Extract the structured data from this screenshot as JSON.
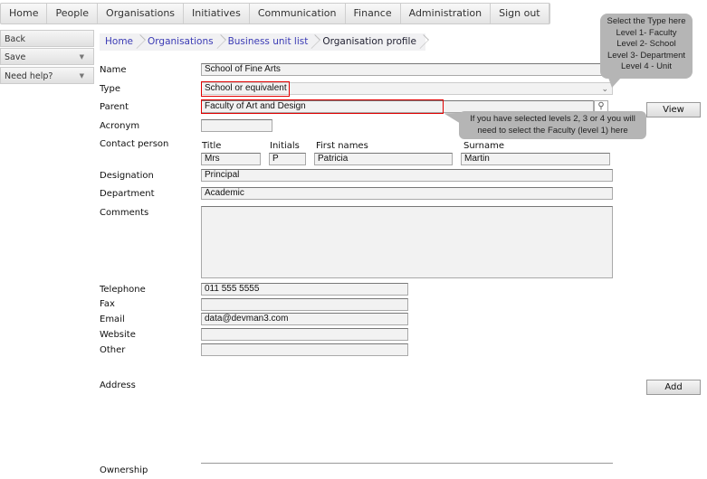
{
  "nav": [
    "Home",
    "People",
    "Organisations",
    "Initiatives",
    "Communication",
    "Finance",
    "Administration",
    "Sign out"
  ],
  "sidebar": {
    "back": "Back",
    "save": "Save",
    "help": "Need help?"
  },
  "breadcrumb": [
    "Home",
    "Organisations",
    "Business unit list",
    "Organisation profile"
  ],
  "form": {
    "name_label": "Name",
    "name": "School of Fine Arts",
    "type_label": "Type",
    "type": "School or equivalent",
    "parent_label": "Parent",
    "parent": "Faculty of Art and Design",
    "view": "View",
    "acronym_label": "Acronym",
    "acronym": "",
    "contact_label": "Contact person",
    "title_label": "Title",
    "title": "Mrs",
    "initials_label": "Initials",
    "initials": "P",
    "first_label": "First names",
    "first": "Patricia",
    "surname_label": "Surname",
    "surname": "Martin",
    "designation_label": "Designation",
    "designation": "Principal",
    "department_label": "Department",
    "department": "Academic",
    "comments_label": "Comments",
    "comments": "",
    "telephone_label": "Telephone",
    "telephone": "011 555 5555",
    "fax_label": "Fax",
    "fax": "",
    "email_label": "Email",
    "email": "data@devman3.com",
    "website_label": "Website",
    "website": "",
    "other_label": "Other",
    "other": "",
    "address_label": "Address",
    "add": "Add",
    "ownership_label": "Ownership"
  },
  "tips": {
    "type": [
      "Select the Type here",
      "Level 1- Faculty",
      "Level 2- School",
      "Level 3- Department",
      "Level 4 - Unit"
    ],
    "parent": [
      "If you have selected levels 2, 3 or 4 you will",
      "need to select the Faculty (level 1) here"
    ]
  }
}
